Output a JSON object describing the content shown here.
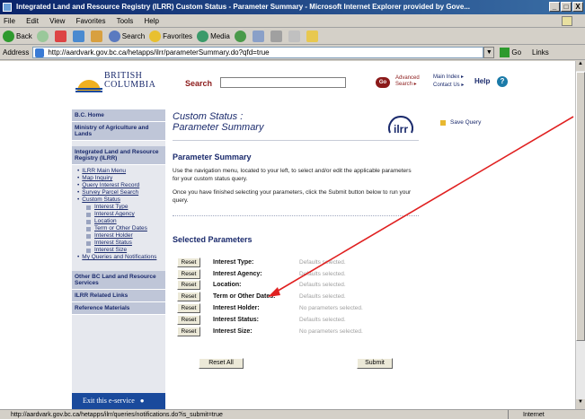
{
  "window": {
    "title": "Integrated Land and Resource Registry (ILRR) Custom Status - Parameter Summary - Microsoft Internet Explorer provided by Gove...",
    "controls": [
      "_",
      "□",
      "X"
    ]
  },
  "menu": [
    "File",
    "Edit",
    "View",
    "Favorites",
    "Tools",
    "Help"
  ],
  "toolbar": {
    "back": "Back",
    "search": "Search",
    "favorites": "Favorites",
    "media": "Media"
  },
  "address": {
    "label": "Address",
    "url": "http://aardvark.gov.bc.ca/hetapps/ilrr/parameterSummary.do?qfd=true",
    "go": "Go",
    "links": "Links"
  },
  "header": {
    "logo_line1": "BRITISH",
    "logo_line2": "COLUMBIA",
    "search_label": "Search",
    "search_value": "",
    "go_label": "Go",
    "advanced_line1": "Advanced",
    "advanced_line2": "Search ▸",
    "main_index": "Main Index ▸",
    "contact_us": "Contact Us ▸",
    "help": "Help"
  },
  "leftnav": {
    "bc_home": "B.C. Home",
    "ministry": "Ministry of Agriculture and Lands",
    "ilrr": "Integrated Land and Resource Registry (ILRR)",
    "links": [
      {
        "label": "ILRR Main Menu"
      },
      {
        "label": "Map Inquiry"
      },
      {
        "label": "Query Interest Record"
      },
      {
        "label": "Survey Parcel Search"
      },
      {
        "label": "Custom Status"
      }
    ],
    "sublinks": [
      {
        "label": "Interest Type"
      },
      {
        "label": "Interest Agency"
      },
      {
        "label": "Location"
      },
      {
        "label": "Term or Other Dates"
      },
      {
        "label": "Interest Holder"
      },
      {
        "label": "Interest Status"
      },
      {
        "label": "Interest Size"
      }
    ],
    "my_queries": "My Queries and Notifications",
    "other_bc": "Other BC Land and Resource Services",
    "ilrr_related": "ILRR Related Links",
    "reference": "Reference Materials",
    "exit": "Exit this e-service"
  },
  "main": {
    "title_line1": "Custom Status :",
    "title_line2": "Parameter Summary",
    "logo_text": "ilrr",
    "save_query": "Save Query",
    "summary_heading": "Parameter Summary",
    "para1": "Use the navigation menu, located to your left, to select and/or edit the applicable parameters for your custom status query.",
    "para2": "Once you have finished selecting your parameters, click the Submit button below to run your query.",
    "selected_heading": "Selected Parameters",
    "reset_label": "Reset",
    "parameters": [
      {
        "label": "Interest Type:",
        "status": "Defaults selected."
      },
      {
        "label": "Interest Agency:",
        "status": "Defaults selected."
      },
      {
        "label": "Location:",
        "status": "Defaults selected."
      },
      {
        "label": "Term or Other Dates:",
        "status": "Defaults selected."
      },
      {
        "label": "Interest Holder:",
        "status": "No parameters selected."
      },
      {
        "label": "Interest Status:",
        "status": "Defaults selected."
      },
      {
        "label": "Interest Size:",
        "status": "No parameters selected."
      }
    ],
    "reset_all": "Reset All",
    "submit": "Submit"
  },
  "status": {
    "url": "http://aardvark.gov.bc.ca/hetapps/ilrr/queries/notifications.do?is_submit=true",
    "zone": "Internet"
  },
  "colors": {
    "nav_bg": "#bfc6d8",
    "brand_blue": "#1a2a6c",
    "annotation_arrow": "#e02020"
  }
}
